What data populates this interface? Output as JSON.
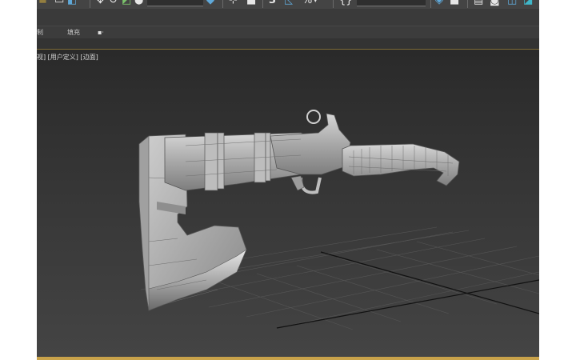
{
  "ribbon": {
    "tab_left": "制",
    "tab_fill": "填充"
  },
  "viewport": {
    "label_prefix": "视]",
    "label_user": "[用户定义]",
    "label_shading": "[边面]"
  },
  "toolbar": {
    "snap_digit": "3",
    "percent_glyph": "%"
  },
  "icons": [
    "move-icon",
    "rotate-icon",
    "scale-icon",
    "snap-icon",
    "angle-snap-icon",
    "percent-snap-icon",
    "render-icon"
  ]
}
